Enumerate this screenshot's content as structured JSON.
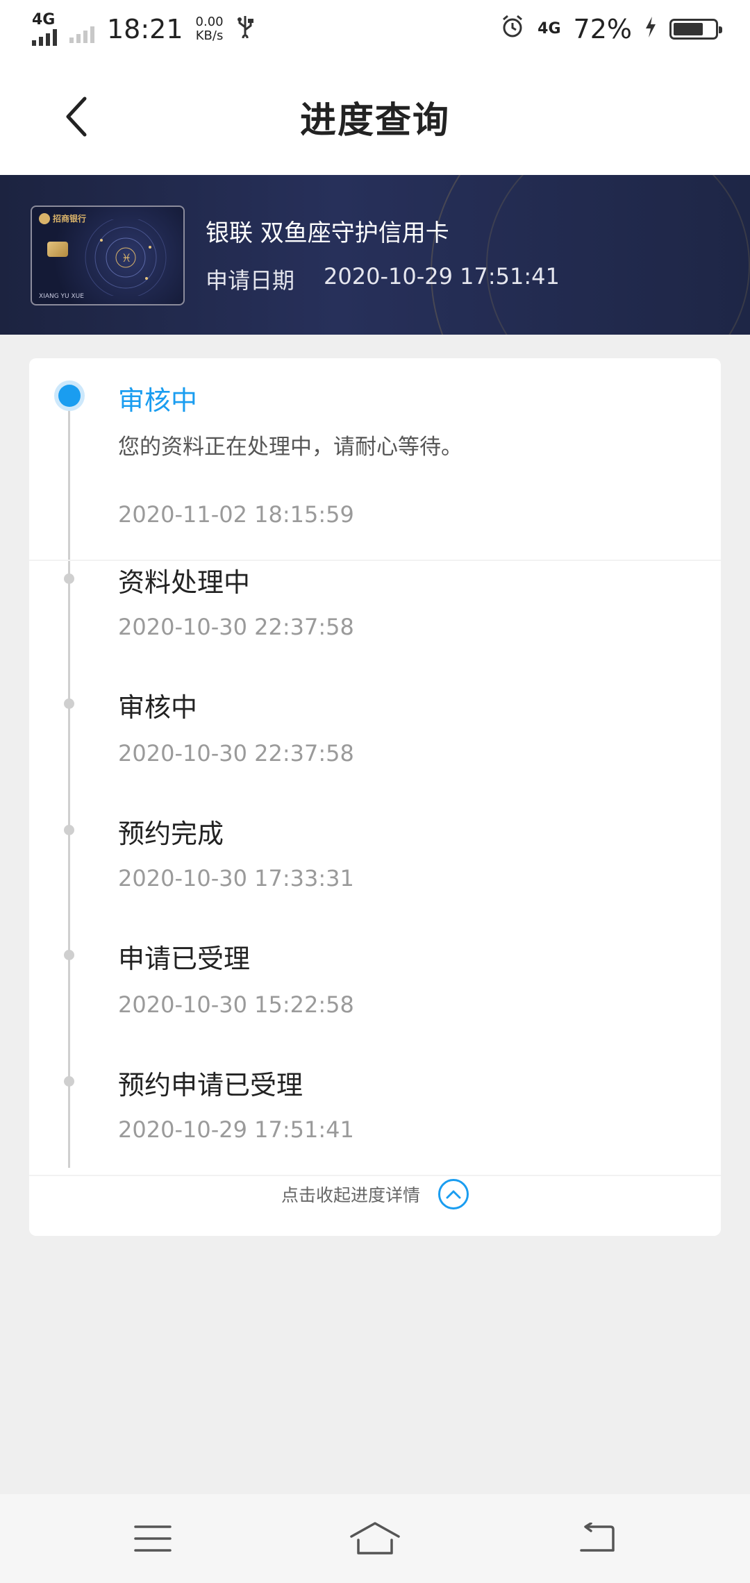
{
  "status_bar": {
    "network_left": "4G",
    "time": "18:21",
    "speed_value": "0.00",
    "speed_unit": "KB/s",
    "network_right": "4G",
    "battery": "72%"
  },
  "header": {
    "title": "进度查询"
  },
  "card": {
    "bank_name": "招商银行",
    "name": "银联 双鱼座守护信用卡",
    "date_label": "申请日期",
    "date_value": "2020-10-29 17:51:41",
    "card_holder_text": "XIANG YU XUE"
  },
  "timeline": {
    "current": {
      "title": "审核中",
      "description": "您的资料正在处理中，请耐心等待。",
      "time": "2020-11-02 18:15:59"
    },
    "history": [
      {
        "title": "资料处理中",
        "time": "2020-10-30 22:37:58"
      },
      {
        "title": "审核中",
        "time": "2020-10-30 22:37:58"
      },
      {
        "title": "预约完成",
        "time": "2020-10-30 17:33:31"
      },
      {
        "title": "申请已受理",
        "time": "2020-10-30 15:22:58"
      },
      {
        "title": "预约申请已受理",
        "time": "2020-10-29 17:51:41"
      }
    ]
  },
  "collapse": {
    "label": "点击收起进度详情"
  },
  "colors": {
    "accent": "#1a9df0",
    "banner": "#1e2646",
    "background": "#efefef"
  },
  "icons": {
    "back": "chevron-left-icon",
    "collapse": "chevron-up-icon",
    "nav_menu": "menu-icon",
    "nav_home": "home-icon",
    "nav_back": "back-icon"
  }
}
